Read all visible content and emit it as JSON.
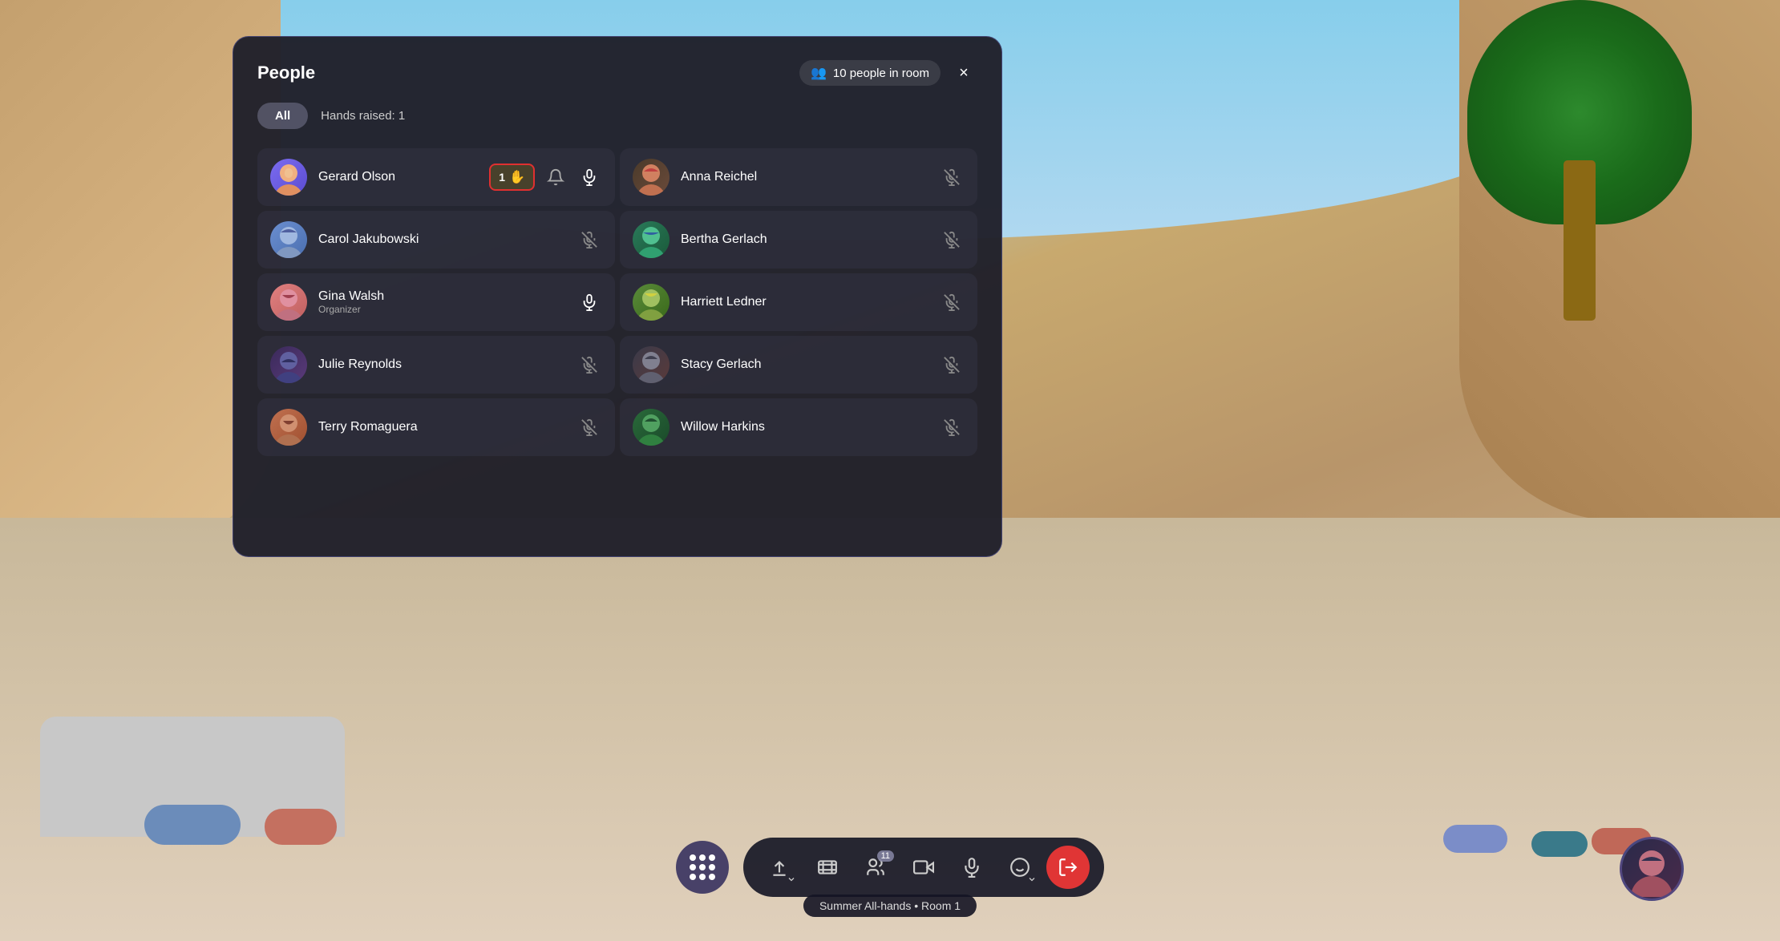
{
  "background": {
    "color": "#5a8ab5"
  },
  "panel": {
    "title": "People",
    "people_count": "10 people in room",
    "close_label": "×",
    "tabs": [
      {
        "id": "all",
        "label": "All",
        "active": true
      },
      {
        "id": "hands",
        "label": "Hands raised: 1",
        "active": false
      }
    ],
    "people": [
      {
        "id": "gerard",
        "name": "Gerard Olson",
        "role": "",
        "hand_raised": true,
        "hand_count": "1",
        "muted": false,
        "col": 0
      },
      {
        "id": "anna",
        "name": "Anna Reichel",
        "role": "",
        "hand_raised": false,
        "muted": true,
        "col": 1
      },
      {
        "id": "carol",
        "name": "Carol Jakubowski",
        "role": "",
        "hand_raised": false,
        "muted": true,
        "col": 0
      },
      {
        "id": "bertha",
        "name": "Bertha Gerlach",
        "role": "",
        "hand_raised": false,
        "muted": true,
        "col": 1
      },
      {
        "id": "gina",
        "name": "Gina Walsh",
        "role": "Organizer",
        "hand_raised": false,
        "muted": false,
        "col": 0
      },
      {
        "id": "harriett",
        "name": "Harriett Ledner",
        "role": "",
        "hand_raised": false,
        "muted": true,
        "col": 1
      },
      {
        "id": "julie",
        "name": "Julie Reynolds",
        "role": "",
        "hand_raised": false,
        "muted": true,
        "col": 0
      },
      {
        "id": "stacy",
        "name": "Stacy Gerlach",
        "role": "",
        "hand_raised": false,
        "muted": true,
        "col": 1
      },
      {
        "id": "terry",
        "name": "Terry Romaguera",
        "role": "",
        "hand_raised": false,
        "muted": true,
        "col": 0
      },
      {
        "id": "willow",
        "name": "Willow Harkins",
        "role": "",
        "hand_raised": false,
        "muted": true,
        "col": 1
      }
    ]
  },
  "toolbar": {
    "room_label": "Summer All-hands • Room 1",
    "buttons": [
      {
        "id": "grid",
        "icon": "⠿",
        "label": "Grid"
      },
      {
        "id": "present",
        "icon": "↑",
        "label": "Present"
      },
      {
        "id": "content",
        "icon": "🎬",
        "label": "Content"
      },
      {
        "id": "people",
        "icon": "👥",
        "label": "People",
        "count": "11"
      },
      {
        "id": "camera",
        "icon": "📷",
        "label": "Camera"
      },
      {
        "id": "mic",
        "icon": "🎙",
        "label": "Microphone"
      },
      {
        "id": "emoji",
        "icon": "☺",
        "label": "Emoji"
      },
      {
        "id": "leave",
        "icon": "📞",
        "label": "Leave",
        "red": true
      }
    ]
  }
}
